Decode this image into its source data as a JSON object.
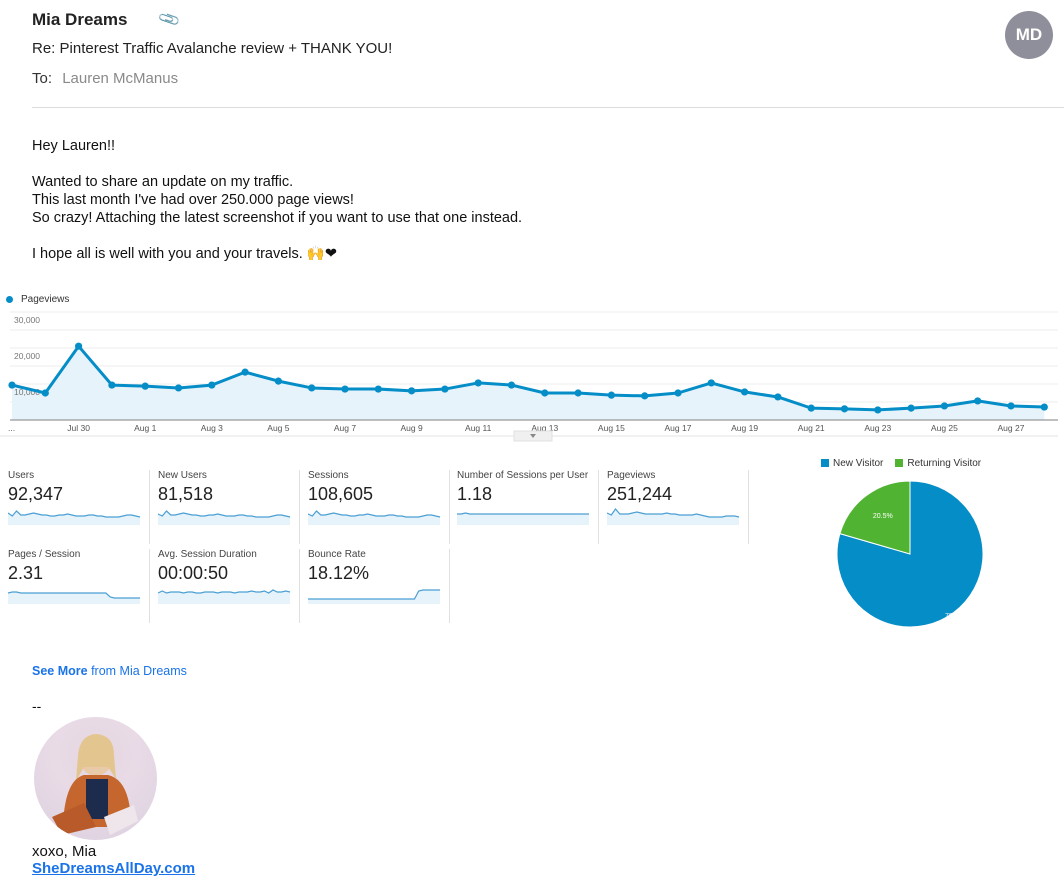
{
  "email": {
    "from": "Mia Dreams",
    "attachment_icon": "paperclip-icon",
    "subject": "Re: Pinterest Traffic Avalanche review + THANK YOU!",
    "to_label": "To:",
    "to": "Lauren McManus",
    "avatar_initials": "MD",
    "body": {
      "greeting": "Hey Lauren!!",
      "line1": "Wanted to share an update on my traffic.",
      "line2": "This last month I've had over 250.000 page views!",
      "line3": "So crazy! Attaching the latest screenshot if you want to use that one instead.",
      "line4": "I hope all is well with you and your travels.",
      "emoji_hands": "🙌",
      "emoji_heart": "❤"
    },
    "see_more_bold": "See More",
    "see_more_rest": " from Mia Dreams",
    "signature": {
      "dash": "--",
      "closing": "xoxo, Mia",
      "link": "SheDreamsAllDay.com"
    }
  },
  "metrics": [
    {
      "label": "Users",
      "value": "92,347"
    },
    {
      "label": "New Users",
      "value": "81,518"
    },
    {
      "label": "Sessions",
      "value": "108,605"
    },
    {
      "label": "Number of Sessions per User",
      "value": "1.18"
    },
    {
      "label": "Pageviews",
      "value": "251,244"
    },
    {
      "label": "Pages / Session",
      "value": "2.31"
    },
    {
      "label": "Avg. Session Duration",
      "value": "00:00:50"
    },
    {
      "label": "Bounce Rate",
      "value": "18.12%"
    }
  ],
  "colors": {
    "series": "#058dc7",
    "area": "#e6f3fb",
    "new_visitor": "#058dc7",
    "returning_visitor": "#50b432"
  },
  "chart_data": [
    {
      "type": "area",
      "title": "",
      "legend": [
        "Pageviews"
      ],
      "legend_position": "top-left",
      "ylim": [
        0,
        30000
      ],
      "yticks": [
        "30,000",
        "20,000",
        "10,000"
      ],
      "grid": true,
      "x_first_label": "...",
      "xtick_labels": [
        "Jul 30",
        "Aug 1",
        "Aug 3",
        "Aug 5",
        "Aug 7",
        "Aug 9",
        "Aug 11",
        "Aug 13",
        "Aug 15",
        "Aug 17",
        "Aug 19",
        "Aug 21",
        "Aug 23",
        "Aug 25",
        "Aug 27"
      ],
      "x": [
        "Jul 28",
        "Jul 29",
        "Jul 30",
        "Jul 31",
        "Aug 1",
        "Aug 2",
        "Aug 3",
        "Aug 4",
        "Aug 5",
        "Aug 6",
        "Aug 7",
        "Aug 8",
        "Aug 9",
        "Aug 10",
        "Aug 11",
        "Aug 12",
        "Aug 13",
        "Aug 14",
        "Aug 15",
        "Aug 16",
        "Aug 17",
        "Aug 18",
        "Aug 19",
        "Aug 20",
        "Aug 21",
        "Aug 22",
        "Aug 23",
        "Aug 24",
        "Aug 25",
        "Aug 26",
        "Aug 27",
        "Aug 28"
      ],
      "series": [
        {
          "name": "Pageviews",
          "values": [
            9700,
            7500,
            20500,
            9700,
            9400,
            8900,
            9700,
            13300,
            10800,
            8900,
            8600,
            8600,
            8100,
            8600,
            10300,
            9700,
            7500,
            7500,
            6900,
            6700,
            7500,
            10300,
            7800,
            6400,
            3300,
            3100,
            2800,
            3300,
            3900,
            5300,
            3900,
            3600
          ]
        }
      ]
    },
    {
      "type": "pie",
      "legend": [
        "New Visitor",
        "Returning Visitor"
      ],
      "legend_position": "top",
      "slices": [
        {
          "label": "New Visitor",
          "value": 79.5,
          "text": "79.5%"
        },
        {
          "label": "Returning Visitor",
          "value": 20.5,
          "text": "20.5%"
        }
      ]
    }
  ]
}
